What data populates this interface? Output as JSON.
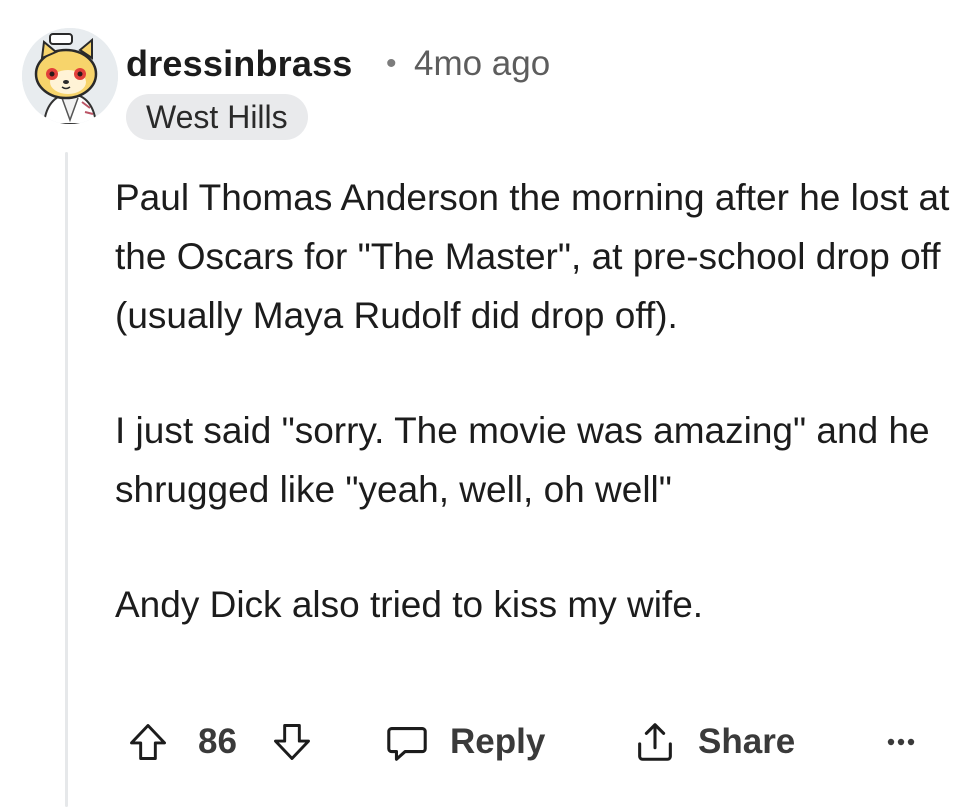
{
  "comment": {
    "author": "dressinbrass",
    "separator": "•",
    "age": "4mo ago",
    "flair": "West Hills",
    "paragraphs": [
      "Paul Thomas Anderson the morning after he lost at the Oscars for \"The Master\", at pre-school drop off (usually Maya Rudolf did drop off).",
      "I just said \"sorry. The movie was amazing\" and he shrugged like \"yeah, well, oh well\"",
      "Andy Dick also tried to kiss my wife."
    ]
  },
  "actions": {
    "vote_count": "86",
    "reply_label": "Reply",
    "share_label": "Share"
  },
  "icons": {
    "upvote": "upvote-arrow-icon",
    "downvote": "downvote-arrow-icon",
    "reply": "speech-bubble-icon",
    "share": "share-arrow-icon",
    "more": "ellipsis-icon"
  },
  "colors": {
    "text": "#1c1c1c",
    "muted": "#5d5d5d",
    "flair_bg": "#e9eaec",
    "thread_line": "#e6e8ea"
  }
}
